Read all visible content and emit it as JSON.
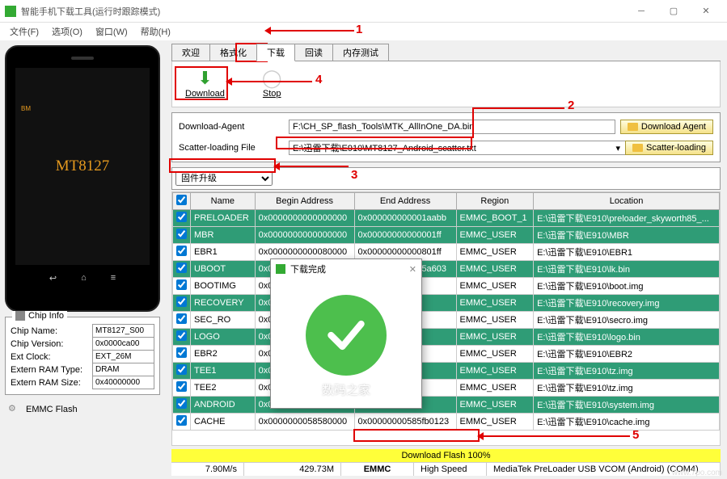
{
  "window": {
    "title": "智能手机下载工具(运行时跟踪模式)"
  },
  "menu": {
    "file": "文件(F)",
    "options": "选项(O)",
    "window": "窗口(W)",
    "help": "帮助(H)"
  },
  "tabs": {
    "welcome": "欢迎",
    "format": "格式化",
    "download": "下载",
    "readback": "回读",
    "memtest": "内存测试"
  },
  "toolbar": {
    "download": "Download",
    "stop": "Stop"
  },
  "paths": {
    "da_label": "Download-Agent",
    "da_value": "F:\\CH_SP_flash_Tools\\MTK_AllInOne_DA.bin",
    "da_btn": "Download Agent",
    "scatter_label": "Scatter-loading File",
    "scatter_value": "E:\\迅雷下载\\E910\\MT8127_Android_scatter.txt",
    "scatter_btn": "Scatter-loading"
  },
  "mode": "固件升级",
  "headers": {
    "name": "Name",
    "begin": "Begin Address",
    "end": "End Address",
    "region": "Region",
    "location": "Location"
  },
  "rows": [
    {
      "c": "g",
      "name": "PRELOADER",
      "b": "0x0000000000000000",
      "e": "0x000000000001aabb",
      "r": "EMMC_BOOT_1",
      "l": "E:\\迅雷下载\\E910\\preloader_skyworth85_..."
    },
    {
      "c": "g",
      "name": "MBR",
      "b": "0x0000000000000000",
      "e": "0x00000000000001ff",
      "r": "EMMC_USER",
      "l": "E:\\迅雷下载\\E910\\MBR"
    },
    {
      "c": "w",
      "name": "EBR1",
      "b": "0x0000000000080000",
      "e": "0x00000000000801ff",
      "r": "EMMC_USER",
      "l": "E:\\迅雷下载\\E910\\EBR1"
    },
    {
      "c": "g",
      "name": "UBOOT",
      "b": "0x0000000001d20000",
      "e": "0x0000000001d5a603",
      "r": "EMMC_USER",
      "l": "E:\\迅雷下载\\E910\\lk.bin"
    },
    {
      "c": "w",
      "name": "BOOTIMG",
      "b": "0x000...",
      "e": "",
      "r": "EMMC_USER",
      "l": "E:\\迅雷下载\\E910\\boot.img"
    },
    {
      "c": "g",
      "name": "RECOVERY",
      "b": "0x000...",
      "e": "",
      "r": "EMMC_USER",
      "l": "E:\\迅雷下载\\E910\\recovery.img"
    },
    {
      "c": "w",
      "name": "SEC_RO",
      "b": "0x000...",
      "e": "",
      "r": "EMMC_USER",
      "l": "E:\\迅雷下载\\E910\\secro.img"
    },
    {
      "c": "g",
      "name": "LOGO",
      "b": "0x000...",
      "e": "",
      "r": "EMMC_USER",
      "l": "E:\\迅雷下载\\E910\\logo.bin"
    },
    {
      "c": "w",
      "name": "EBR2",
      "b": "0x000...",
      "e": "",
      "r": "EMMC_USER",
      "l": "E:\\迅雷下载\\E910\\EBR2"
    },
    {
      "c": "g",
      "name": "TEE1",
      "b": "0x000...",
      "e": "",
      "r": "EMMC_USER",
      "l": "E:\\迅雷下载\\E910\\tz.img"
    },
    {
      "c": "w",
      "name": "TEE2",
      "b": "0x000...",
      "e": "",
      "r": "EMMC_USER",
      "l": "E:\\迅雷下载\\E910\\tz.img"
    },
    {
      "c": "g",
      "name": "ANDROID",
      "b": "0x000...",
      "e": "",
      "r": "EMMC_USER",
      "l": "E:\\迅雷下载\\E910\\system.img"
    },
    {
      "c": "w",
      "name": "CACHE",
      "b": "0x0000000058580000",
      "e": "0x00000000585fb0123",
      "r": "EMMC_USER",
      "l": "E:\\迅雷下载\\E910\\cache.img"
    }
  ],
  "status": {
    "bar": "Download Flash 100%",
    "speed": "7.90M/s",
    "size": "429.73M",
    "dev": "EMMC",
    "mode": "High Speed",
    "port": "MediaTek PreLoader USB VCOM (Android) (COM4)"
  },
  "phone_model": "MT8127",
  "chip": {
    "legend": "Chip Info",
    "name_l": "Chip Name:",
    "name_v": "MT8127_S00",
    "ver_l": "Chip Version:",
    "ver_v": "0x0000ca00",
    "clk_l": "Ext Clock:",
    "clk_v": "EXT_26M",
    "ram_l": "Extern RAM Type:",
    "ram_v": "DRAM",
    "rsz_l": "Extern RAM Size:",
    "rsz_v": "0x40000000"
  },
  "emmc_label": "EMMC Flash",
  "popup": {
    "title": "下载完成",
    "wm": "数码之家"
  },
  "ann": {
    "n1": "1",
    "n2": "2",
    "n3": "3",
    "n4": "4",
    "n5": "5"
  },
  "footer_wm": "www.7po.com"
}
